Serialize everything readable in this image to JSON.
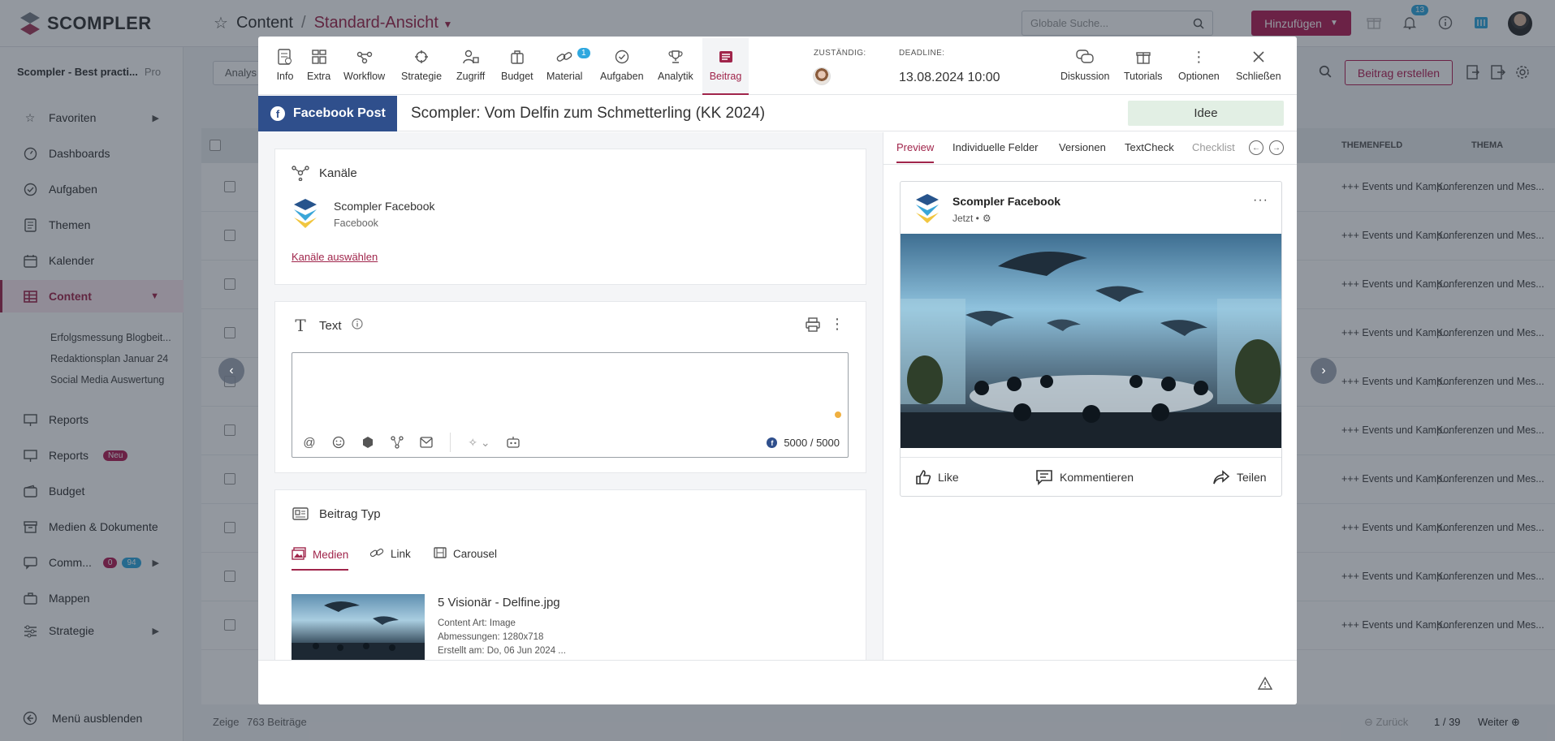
{
  "app": {
    "brand": "SCOMPLER",
    "breadcrumb": {
      "section": "Content",
      "separator": "/",
      "view": "Standard-Ansicht"
    },
    "search_placeholder": "Globale Suche...",
    "add_button": "Hinzufügen",
    "notification_count": "13",
    "workspace": {
      "name": "Scompler - Best practi...",
      "plan": "Pro"
    }
  },
  "sidebar": {
    "items": [
      {
        "label": "Favoriten",
        "icon": "star-icon",
        "arrow": true
      },
      {
        "label": "Dashboards",
        "icon": "gauge-icon"
      },
      {
        "label": "Aufgaben",
        "icon": "check-circle-icon"
      },
      {
        "label": "Themen",
        "icon": "document-icon"
      },
      {
        "label": "Kalender",
        "icon": "calendar-icon"
      },
      {
        "label": "Content",
        "icon": "table-icon",
        "active": true
      },
      {
        "label": "Reports",
        "icon": "presentation-icon"
      },
      {
        "label": "Reports",
        "icon": "presentation-icon",
        "badge": "Neu"
      },
      {
        "label": "Budget",
        "icon": "wallet-icon"
      },
      {
        "label": "Medien & Dokumente",
        "icon": "archive-icon"
      },
      {
        "label": "Comm...",
        "icon": "chat-icon",
        "badge_a": "0",
        "badge_b": "94",
        "arrow": true
      },
      {
        "label": "Mappen",
        "icon": "briefcase-icon"
      },
      {
        "label": "Strategie",
        "icon": "sliders-icon",
        "arrow": true
      }
    ],
    "sub_items": [
      "Erfolgsmessung Blogbeit...",
      "Redaktionsplan Januar 24",
      "Social Media Auswertung"
    ],
    "hide_menu": "Menü ausblenden"
  },
  "list": {
    "filter_label": "Analys",
    "create_button": "Beitrag erstellen",
    "columns": {
      "themenfeld": "THEMENFELD",
      "thema": "THEMA"
    },
    "row_col1": "+++ Events und Kamp...",
    "row_col2": "Konferenzen und Mes...",
    "footer": {
      "showing": "Zeige",
      "count": "763 Beiträge",
      "back": "Zurück",
      "page": "1 / 39",
      "next": "Weiter"
    }
  },
  "modal": {
    "toolbar": [
      {
        "label": "Info",
        "icon": "info-doc-icon"
      },
      {
        "label": "Extra",
        "icon": "grid-icon"
      },
      {
        "label": "Workflow",
        "icon": "workflow-icon"
      },
      {
        "label": "Strategie",
        "icon": "crosshair-icon"
      },
      {
        "label": "Zugriff",
        "icon": "user-lock-icon"
      },
      {
        "label": "Budget",
        "icon": "wallet-icon"
      },
      {
        "label": "Material",
        "icon": "link-icon",
        "badge": "1"
      },
      {
        "label": "Aufgaben",
        "icon": "check-circle-icon"
      },
      {
        "label": "Analytik",
        "icon": "trophy-icon"
      },
      {
        "label": "Beitrag",
        "icon": "newspaper-icon",
        "active": true
      }
    ],
    "assignee_label": "ZUSTÄNDIG:",
    "deadline_label": "DEADLINE:",
    "deadline": "13.08.2024 10:00",
    "right_actions": [
      {
        "label": "Diskussion",
        "icon": "chat-bubbles-icon"
      },
      {
        "label": "Tutorials",
        "icon": "gift-box-icon"
      },
      {
        "label": "Optionen",
        "icon": "more-vertical-icon"
      },
      {
        "label": "Schließen",
        "icon": "close-icon"
      }
    ],
    "post_type": "Facebook Post",
    "title": "Scompler: Vom Delfin zum Schmetterling (KK 2024)",
    "status": "Idee",
    "channels": {
      "heading": "Kanäle",
      "channel_name": "Scompler Facebook",
      "channel_type": "Facebook",
      "choose_link": "Kanäle auswählen"
    },
    "text_section": {
      "heading": "Text",
      "char_count": "5000 / 5000"
    },
    "post_type_section": {
      "heading": "Beitrag Typ",
      "tabs": [
        {
          "label": "Medien",
          "icon": "images-icon",
          "active": true
        },
        {
          "label": "Link",
          "icon": "link-icon"
        },
        {
          "label": "Carousel",
          "icon": "film-icon"
        }
      ],
      "media": {
        "filename": "5 Visionär - Delfine.jpg",
        "type": "Content Art: Image",
        "dimensions": "Abmessungen: 1280x718",
        "created": "Erstellt am: Do, 06 Jun 2024 ..."
      }
    },
    "right_tabs": [
      {
        "label": "Preview",
        "active": true
      },
      {
        "label": "Individuelle Felder"
      },
      {
        "label": "Versionen"
      },
      {
        "label": "TextCheck"
      },
      {
        "label": "Checklist"
      }
    ],
    "preview": {
      "page_name": "Scompler Facebook",
      "time": "Jetzt •",
      "actions": [
        "Like",
        "Kommentieren",
        "Teilen"
      ]
    }
  },
  "colors": {
    "brand": "#a0254b",
    "primary_button": "#b31e55",
    "facebook": "#2f4f8c",
    "status_idee": "#e2efe4",
    "badge_blue": "#2fa8df"
  }
}
